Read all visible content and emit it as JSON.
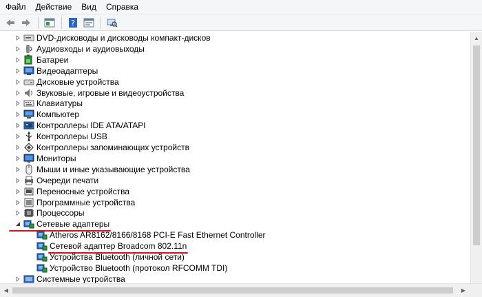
{
  "menu": [
    "Файл",
    "Действие",
    "Вид",
    "Справка"
  ],
  "toolbar": {
    "buttons": [
      "back-arrow-icon",
      "forward-arrow-icon",
      "properties-icon",
      "help-icon",
      "show-hide-icon",
      "scan-hardware-icon"
    ]
  },
  "tree": {
    "categories": [
      {
        "label": "DVD-дисководы и дисководы компакт-дисков",
        "icon": "dvd-drive-icon",
        "expanded": false
      },
      {
        "label": "Аудиовходы и аудиовыходы",
        "icon": "audio-io-icon",
        "expanded": false
      },
      {
        "label": "Батареи",
        "icon": "battery-icon",
        "expanded": false
      },
      {
        "label": "Видеоадаптеры",
        "icon": "display-adapter-icon",
        "expanded": false
      },
      {
        "label": "Дисковые устройства",
        "icon": "disk-drive-icon",
        "expanded": false
      },
      {
        "label": "Звуковые, игровые и видеоустройства",
        "icon": "sound-icon",
        "expanded": false
      },
      {
        "label": "Клавиатуры",
        "icon": "keyboard-icon",
        "expanded": false
      },
      {
        "label": "Компьютер",
        "icon": "computer-icon",
        "expanded": false
      },
      {
        "label": "Контроллеры IDE ATA/ATAPI",
        "icon": "ide-controller-icon",
        "expanded": false
      },
      {
        "label": "Контроллеры USB",
        "icon": "usb-icon",
        "expanded": false
      },
      {
        "label": "Контроллеры запоминающих устройств",
        "icon": "storage-controller-icon",
        "expanded": false
      },
      {
        "label": "Мониторы",
        "icon": "monitor-icon",
        "expanded": false
      },
      {
        "label": "Мыши и иные указывающие устройства",
        "icon": "mouse-icon",
        "expanded": false
      },
      {
        "label": "Очереди печати",
        "icon": "printer-icon",
        "expanded": false
      },
      {
        "label": "Переносные устройства",
        "icon": "portable-device-icon",
        "expanded": false
      },
      {
        "label": "Программные устройства",
        "icon": "software-device-icon",
        "expanded": false
      },
      {
        "label": "Процессоры",
        "icon": "processor-icon",
        "expanded": false
      },
      {
        "label": "Сетевые адаптеры",
        "icon": "network-adapter-icon",
        "expanded": true,
        "children": [
          "Atheros AR8162/8166/8168 PCI-E Fast Ethernet Controller",
          "Сетевой адаптер Broadcom 802.11n",
          "Устройства Bluetooth (личной сети)",
          "Устройство Bluetooth (протокол RFCOMM TDI)"
        ]
      },
      {
        "label": "Системные устройства",
        "icon": "system-device-icon",
        "expanded": false
      }
    ]
  },
  "colors": {
    "annotation": "#d0141e",
    "network_icon": "#1f6fc1"
  }
}
